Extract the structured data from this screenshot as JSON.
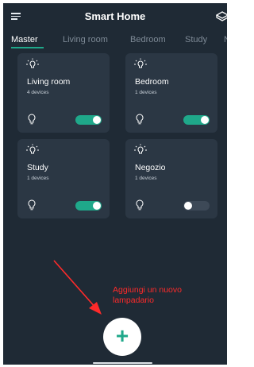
{
  "header": {
    "title": "Smart Home",
    "menu_icon": "hamburger-menu-icon",
    "right_icon": "cube-icon"
  },
  "tabs": [
    {
      "label": "Master",
      "active": true
    },
    {
      "label": "Living room",
      "active": false
    },
    {
      "label": "Bedroom",
      "active": false
    },
    {
      "label": "Study",
      "active": false
    },
    {
      "label": "N",
      "active": false
    }
  ],
  "cards": [
    {
      "name": "Living room",
      "devices": "4 devices",
      "on": true
    },
    {
      "name": "Bedroom",
      "devices": "1 devices",
      "on": true
    },
    {
      "name": "Study",
      "devices": "1 devices",
      "on": true
    },
    {
      "name": "Negozio",
      "devices": "1 devices",
      "on": false
    }
  ],
  "add_button": {
    "label": "+"
  },
  "annotation": {
    "line1": "Aggiungi un nuovo",
    "line2": "lampadario",
    "color": "#ff2a2a"
  },
  "colors": {
    "background": "#1f2a35",
    "card": "#2b3744",
    "accent": "#1fa88a",
    "toggle_off": "#3d4957"
  }
}
